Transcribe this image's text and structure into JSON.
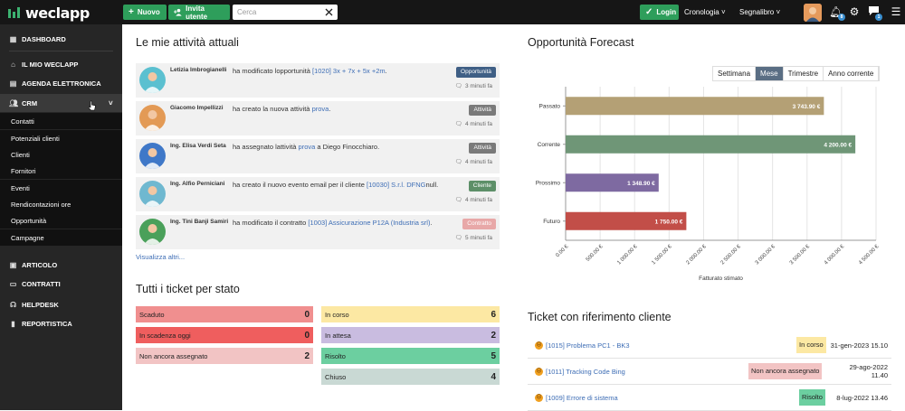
{
  "topbar": {
    "logo": "weclapp",
    "new_label": "Nuovo",
    "invite_label": "Invita utente",
    "search_placeholder": "Cerca",
    "login_label": "Login",
    "history_label": "Cronologia",
    "bookmark_label": "Segnalibro",
    "notif_count": "8",
    "msg_count": "1"
  },
  "sidebar": {
    "dashboard": "DASHBOARD",
    "my_weclapp": "IL MIO WECLAPP",
    "agenda": "AGENDA ELETTRONICA",
    "crm": "CRM",
    "crm_items": [
      "Contatti",
      "Potenziali clienti",
      "Clienti",
      "Fornitori",
      "Eventi",
      "Rendicontazioni ore",
      "Opportunità",
      "Campagne"
    ],
    "articolo": "ARTICOLO",
    "contratti": "CONTRATTI",
    "helpdesk": "HELPDESK",
    "reportistica": "REPORTISTICA"
  },
  "activities": {
    "title": "Le mie attività attuali",
    "show_more": "Visualizza altri...",
    "items": [
      {
        "who": "Letizia Imbrogianelli",
        "pre": "ha modificato lopportunità ",
        "link": "[1020] 3x + 7x + 5x +2m",
        "post": ".",
        "post2": "",
        "tag": "Opportunità",
        "tag_color": "#3f5f85",
        "time": "3 minuti fa"
      },
      {
        "who": "Giacomo Impellizzi",
        "pre": "ha creato la nuova attività ",
        "link": "prova",
        "post": ".",
        "post2": "",
        "tag": "Attività",
        "tag_color": "#7a7a7a",
        "time": "4 minuti fa"
      },
      {
        "who": "Ing. Elisa Verdi Seta",
        "pre": "ha assegnato lattività ",
        "link": "prova",
        "post": " a Diego Finocchiaro.",
        "post2": "",
        "tag": "Attività",
        "tag_color": "#7a7a7a",
        "time": "4 minuti fa"
      },
      {
        "who": "Ing. Alfio Perniciani",
        "pre": "ha creato il nuovo evento email per il cliente ",
        "link": "[10030] S.r.l. DFNG",
        "post": "null.",
        "post2": "",
        "tag": "Cliente",
        "tag_color": "#5d8f68",
        "time": "4 minuti fa"
      },
      {
        "who": "Ing. Tini Banji Samiri",
        "pre": "ha modificato il contratto ",
        "link": "[1003] Assicurazione P12A (Industria srl)",
        "post": ".",
        "post2": "",
        "tag": "Contratto",
        "tag_color": "#e8a8a8",
        "time": "5 minuti fa"
      }
    ]
  },
  "tickets_state": {
    "title": "Tutti i ticket per stato",
    "left": [
      {
        "label": "Scaduto",
        "count": "0",
        "color": "#f08f8f"
      },
      {
        "label": "In scadenza oggi",
        "count": "0",
        "color": "#ef5e5e"
      },
      {
        "label": "Non ancora assegnato",
        "count": "2",
        "color": "#f2c4c4"
      }
    ],
    "right": [
      {
        "label": "In corso",
        "count": "6",
        "color": "#fce8a3"
      },
      {
        "label": "In attesa",
        "count": "2",
        "color": "#c9bce0"
      },
      {
        "label": "Risolto",
        "count": "5",
        "color": "#6ccfa0"
      },
      {
        "label": "Chiuso",
        "count": "4",
        "color": "#c9d9d4"
      }
    ]
  },
  "forecast": {
    "title": "Opportunità Forecast",
    "periods": [
      "Settimana",
      "Mese",
      "Trimestre",
      "Anno corrente"
    ],
    "active_period": "Mese"
  },
  "chart_data": {
    "type": "bar",
    "orientation": "horizontal",
    "categories": [
      "Passato",
      "Corrente",
      "Prossimo",
      "Futuro"
    ],
    "values": [
      3743.9,
      4200.0,
      1348.9,
      1750.0
    ],
    "value_labels": [
      "3 743.90 €",
      "4 200.00 €",
      "1 348.90 €",
      "1 750.00 €"
    ],
    "colors": [
      "#b4a075",
      "#6f9677",
      "#7e6aa1",
      "#c24e48"
    ],
    "xlabel": "Fatturato stimato",
    "xlim": [
      0,
      4500
    ],
    "xticks": [
      "0.00 €",
      "500.00 €",
      "1 000.00 €",
      "1 500.00 €",
      "2 000.00 €",
      "2 500.00 €",
      "3 000.00 €",
      "3 500.00 €",
      "4 000.00 €",
      "4 500.00 €"
    ],
    "grid": true
  },
  "customer_tickets": {
    "title": "Ticket con riferimento cliente",
    "items": [
      {
        "title": "[1015] Problema PC1 - BK3",
        "status": "In corso",
        "status_color": "#fce8a3",
        "date": "31-gen-2023 15.10",
        "date2": ""
      },
      {
        "title": "[1011] Tracking Code Bing",
        "status": "Non ancora assegnato",
        "status_color": "#f2c4c4",
        "date": "29-ago-2022",
        "date2": "11.40"
      },
      {
        "title": "[1009] Errore di sistema",
        "status": "Risolto",
        "status_color": "#6ccfa0",
        "date": "8-lug-2022 13.46",
        "date2": ""
      }
    ]
  }
}
